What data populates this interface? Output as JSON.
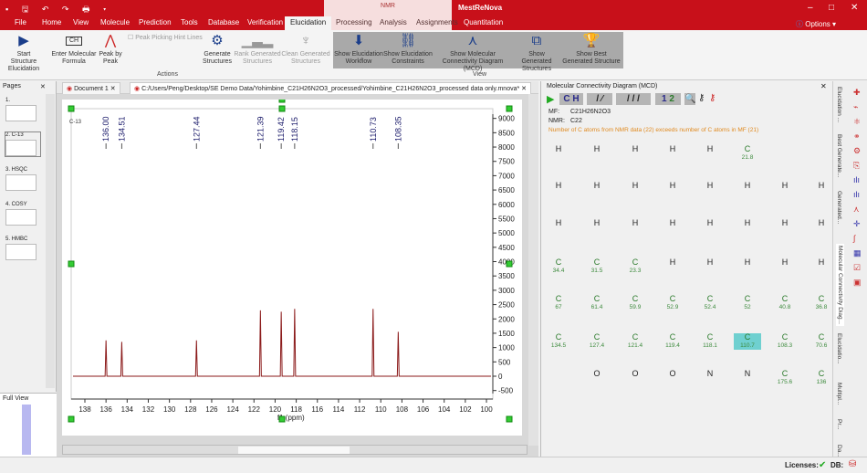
{
  "app": {
    "title": "MestReNova",
    "context_group": "NMR",
    "quick_access": "▪ 🖫 ↶ ↷ 🖶 ▾",
    "options": "Options"
  },
  "tabs": [
    "File",
    "Home",
    "View",
    "Molecule",
    "Prediction",
    "Tools",
    "Database",
    "Verification",
    "Elucidation",
    "Processing",
    "Analysis",
    "Assignments",
    "Quantitation"
  ],
  "ribbon": {
    "start": "Start Structure Elucidation",
    "enter_mf": "Enter Molecular Formula",
    "peak_by_peak": "Peak by Peak",
    "hint_lines": "Peak Picking Hint Lines",
    "generate": "Generate Structures",
    "rank": "Rank Generated Structures",
    "clean": "Clean Generated Structures",
    "actions_group": "Actions",
    "show_workflow": "Show Elucidation Workflow",
    "show_constraints": "Show Elucidation Constraints",
    "show_mcd": "Show Molecular Connectivity Diagram (MCD)",
    "show_generated": "Show Generated Structures",
    "show_best": "Show Best Generated Structure",
    "view_group": "View"
  },
  "pages": {
    "title": "Pages",
    "items": [
      "1.",
      "2. C-13",
      "3. HSQC",
      "4. COSY",
      "5. HMBC"
    ],
    "full_view": "Full View"
  },
  "doc_tabs": [
    "Document 1",
    "C:/Users/Peng/Desktop/SE Demo Data/Yohimbine_C21H26N2O3_processed/Yohimbine_C21H26N2O3_processed data only.mnova*"
  ],
  "spectrum": {
    "label": "C-13",
    "xlabel": "f1 (ppm)",
    "x_ticks": [
      138,
      136,
      134,
      132,
      130,
      128,
      126,
      124,
      122,
      120,
      118,
      116,
      114,
      112,
      110,
      108,
      106,
      104,
      102,
      100
    ],
    "y_ticks": [
      9000,
      8500,
      8000,
      7500,
      7000,
      6500,
      6000,
      5500,
      5000,
      4500,
      4000,
      3500,
      3000,
      2500,
      2000,
      1500,
      1000,
      500,
      0,
      -500
    ],
    "peaks": [
      {
        "ppm": 136.0,
        "label": "136.00",
        "h": 1250
      },
      {
        "ppm": 134.51,
        "label": "134.51",
        "h": 1200
      },
      {
        "ppm": 127.44,
        "label": "127.44",
        "h": 1250
      },
      {
        "ppm": 121.39,
        "label": "121.39",
        "h": 2300
      },
      {
        "ppm": 119.42,
        "label": "119.42",
        "h": 2250
      },
      {
        "ppm": 118.15,
        "label": "118.15",
        "h": 2350
      },
      {
        "ppm": 110.73,
        "label": "110.73",
        "h": 2350
      },
      {
        "ppm": 108.35,
        "label": "108.35",
        "h": 1550
      }
    ]
  },
  "mcd": {
    "title": "Molecular Connectivity Diagram (MCD)",
    "mf_label": "MF:",
    "mf": "C21H26N2O3",
    "nmr_label": "NMR:",
    "nmr": "C22",
    "warning": "Number of C atoms from NMR data (22) exceeds number of C atoms in MF (21)",
    "toolbar": [
      "C",
      "H",
      "/ ⁄",
      "/ / /",
      "1",
      "2"
    ],
    "grid": [
      [
        [
          "H"
        ],
        [
          "H"
        ],
        [
          "H"
        ],
        [
          "H"
        ],
        [
          "H"
        ],
        [
          "C",
          "21.8"
        ],
        [],
        []
      ],
      [
        [
          "H"
        ],
        [
          "H"
        ],
        [
          "H"
        ],
        [
          "H"
        ],
        [
          "H"
        ],
        [
          "H"
        ],
        [
          "H"
        ],
        [
          "H"
        ]
      ],
      [
        [
          "H"
        ],
        [
          "H"
        ],
        [
          "H"
        ],
        [
          "H"
        ],
        [
          "H"
        ],
        [
          "H"
        ],
        [
          "H"
        ],
        [
          "H"
        ]
      ],
      [
        [
          "C",
          "34.4"
        ],
        [
          "C",
          "31.5"
        ],
        [
          "C",
          "23.3"
        ],
        [
          "H"
        ],
        [
          "H"
        ],
        [
          "H"
        ],
        [
          "H"
        ],
        [
          "H"
        ]
      ],
      [
        [
          "C",
          "67"
        ],
        [
          "C",
          "61.4"
        ],
        [
          "C",
          "59.9"
        ],
        [
          "C",
          "52.9"
        ],
        [
          "C",
          "52.4"
        ],
        [
          "C",
          "52"
        ],
        [
          "C",
          "40.8"
        ],
        [
          "C",
          "36.8"
        ]
      ],
      [
        [
          "C",
          "134.5"
        ],
        [
          "C",
          "127.4"
        ],
        [
          "C",
          "121.4"
        ],
        [
          "C",
          "119.4"
        ],
        [
          "C",
          "118.1"
        ],
        [
          "C",
          "110.7"
        ],
        [
          "C",
          "108.3"
        ],
        [
          "C",
          "70.6"
        ]
      ],
      [
        [],
        [
          "O"
        ],
        [
          "O"
        ],
        [
          "O"
        ],
        [
          "N"
        ],
        [
          "N"
        ],
        [
          "C",
          "175.6"
        ],
        [
          "C",
          "136"
        ]
      ]
    ],
    "highlight": [
      5,
      5
    ]
  },
  "side_tabs": [
    "Elucidation ...",
    "Best Generate...",
    "Generated...",
    "Molecular Connectivity Diag...",
    "Elucidatio...",
    "Multipl...",
    "Pr...",
    "Da..."
  ],
  "status": {
    "licenses": "Licenses:",
    "db": "DB:"
  },
  "colors": {
    "brand": "#c8101a",
    "spectrum": "#8b1a1a",
    "peak_label": "#1a1a6a",
    "highlight": "#6fd0d0"
  }
}
